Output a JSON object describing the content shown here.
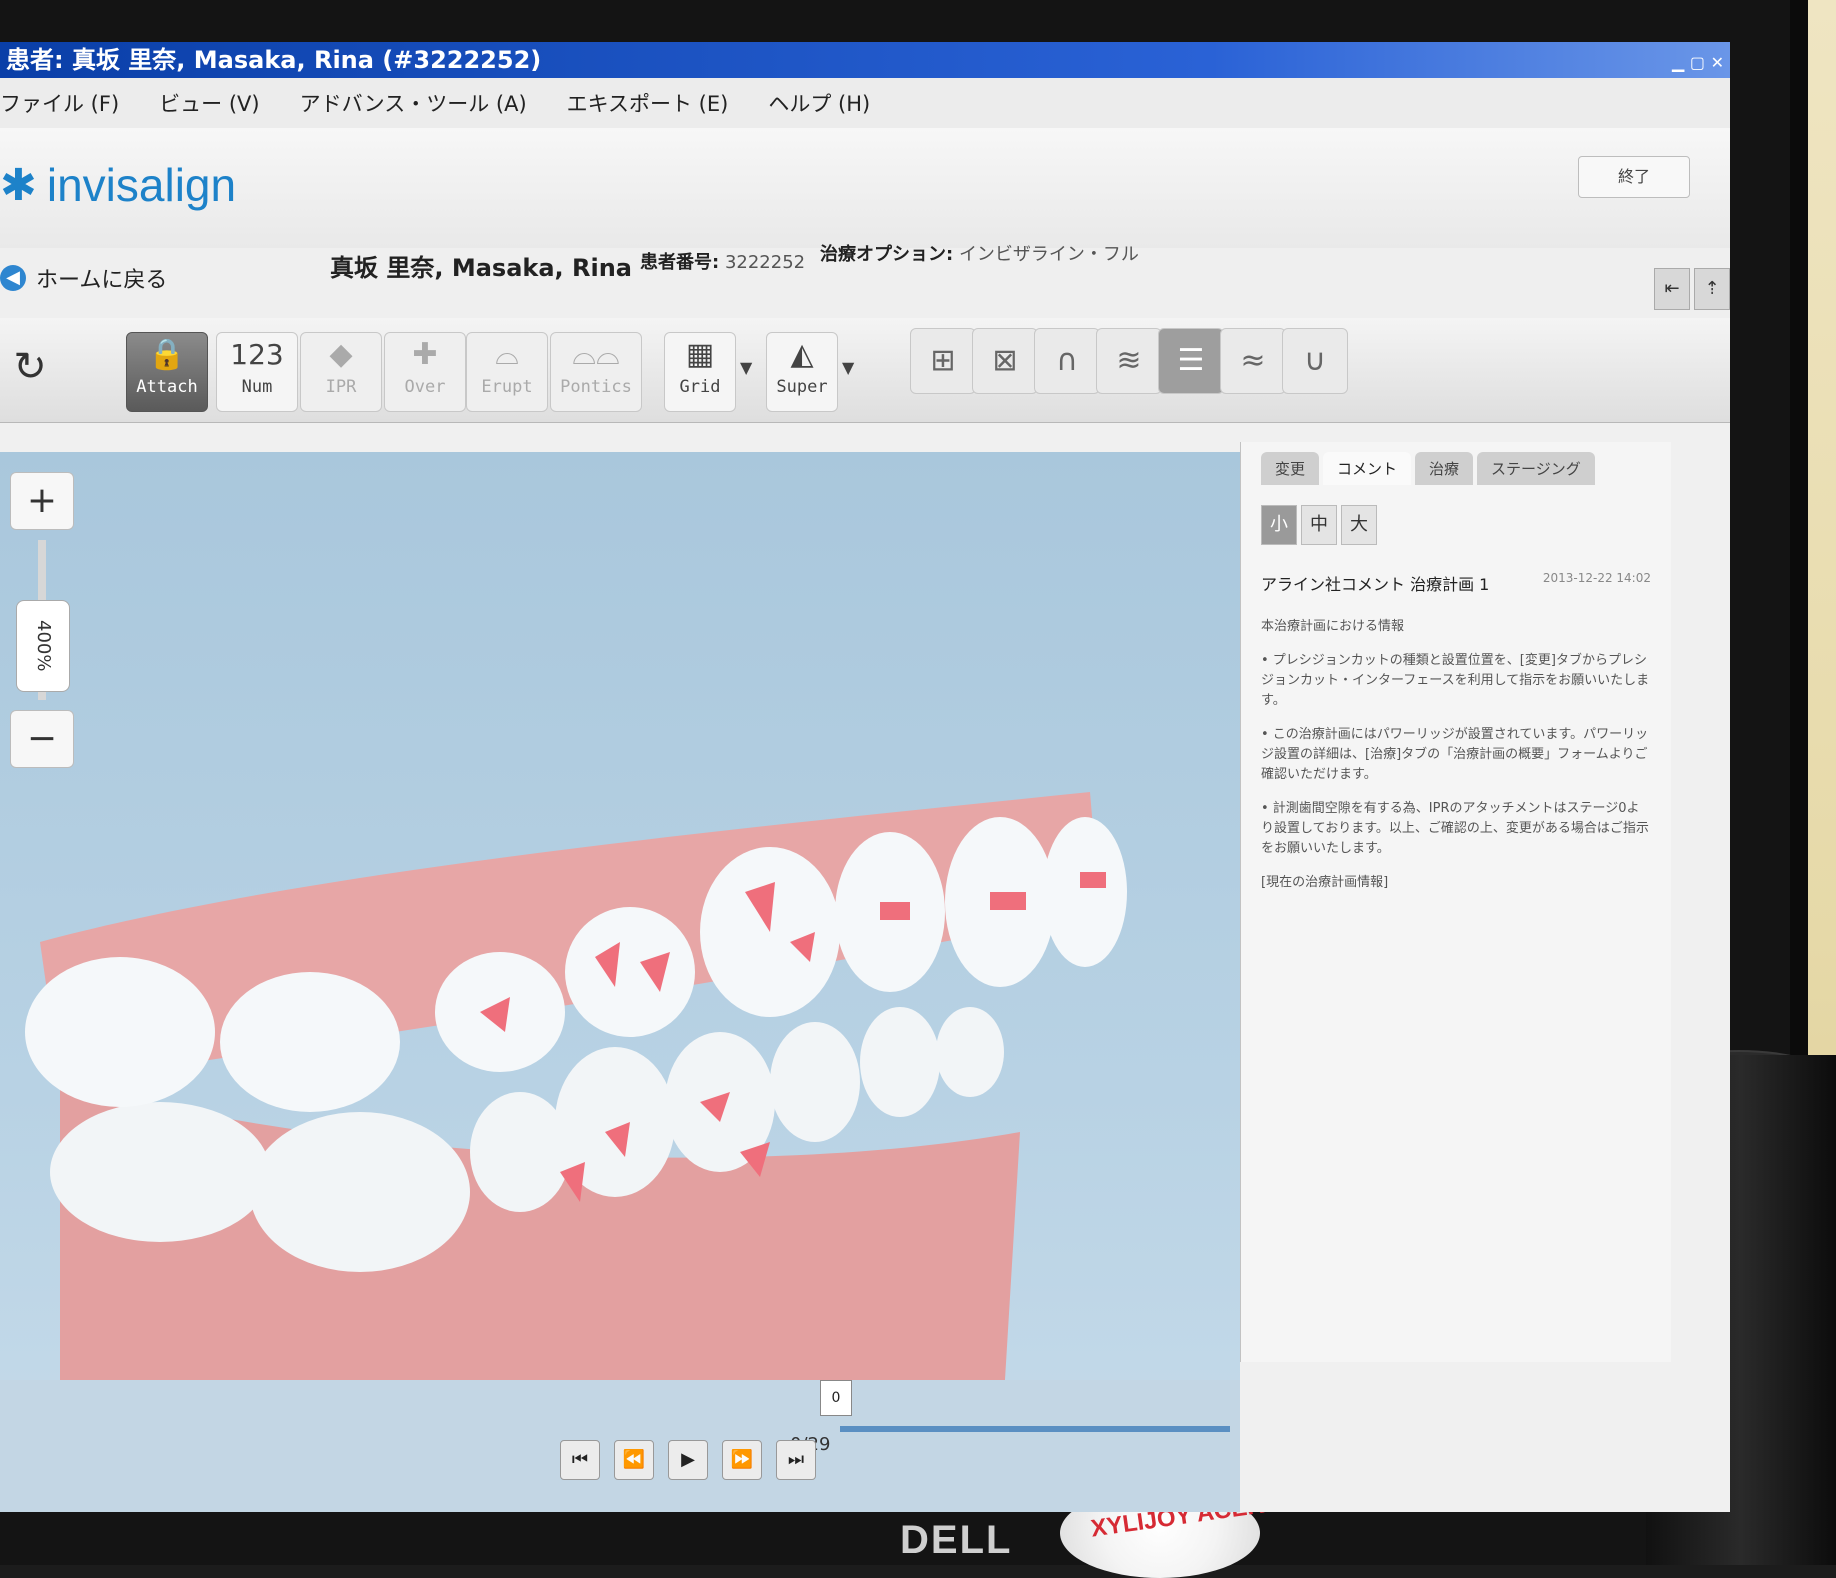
{
  "window": {
    "title": "患者: 真坂 里奈, Masaka, Rina (#3222252)"
  },
  "menu": {
    "items": [
      "ファイル (F)",
      "ビュー (V)",
      "アドバンス・ツール (A)",
      "エキスポート (E)",
      "ヘルプ (H)"
    ]
  },
  "brand": {
    "logo_text": "invisalign",
    "close_label": "終了"
  },
  "patient": {
    "home_label": "ホームに戻る",
    "name": "真坂 里奈, Masaka, Rina",
    "number_label": "患者番号:",
    "number_value": "3222252",
    "option_label": "治療オプション:",
    "option_value": "インビザライン・フル"
  },
  "toolbar": {
    "attach_label": "Attach",
    "num_glyph": "123",
    "num_label": "Num",
    "ipr_label": "IPR",
    "over_label": "Over",
    "erupt_label": "Erupt",
    "pontics_label": "Pontics",
    "grid_label": "Grid",
    "super_label": "Super"
  },
  "zoom": {
    "level": "400%"
  },
  "panel": {
    "tabs": [
      "変更",
      "コメント",
      "治療",
      "ステージング"
    ],
    "sizes": [
      "小",
      "中",
      "大"
    ],
    "comment_title": "アライン社コメント  治療計画  1",
    "comment_date": "2013-12-22 14:02",
    "comment_paragraphs": [
      "本治療計画における情報",
      "• プレシジョンカットの種類と設置位置を、[変更]タブからプレシジョンカット・インターフェースを利用して指示をお願いいたします。",
      "• この治療計画にはパワーリッジが設置されています。パワーリッジ設置の詳細は、[治療]タブの「治療計画の概要」フォームよりご確認いただけます。",
      "• 計測歯間空隙を有する為、IPRのアタッチメントはステージ0より設置しております。以上、ご確認の上、変更がある場合はご指示をお願いいたします。",
      "[現在の治療計画情報]"
    ]
  },
  "playback": {
    "counter": "0/29",
    "marker": "0"
  },
  "overlay": {
    "dell_logo": "DELL",
    "bottle_label": "XYLIJOY ACEROLA"
  },
  "colors": {
    "brand_blue": "#1d82c9",
    "gum": "#e9a8a8",
    "tooth": "#f4f7f9",
    "attachment": "#ef6f7c"
  }
}
